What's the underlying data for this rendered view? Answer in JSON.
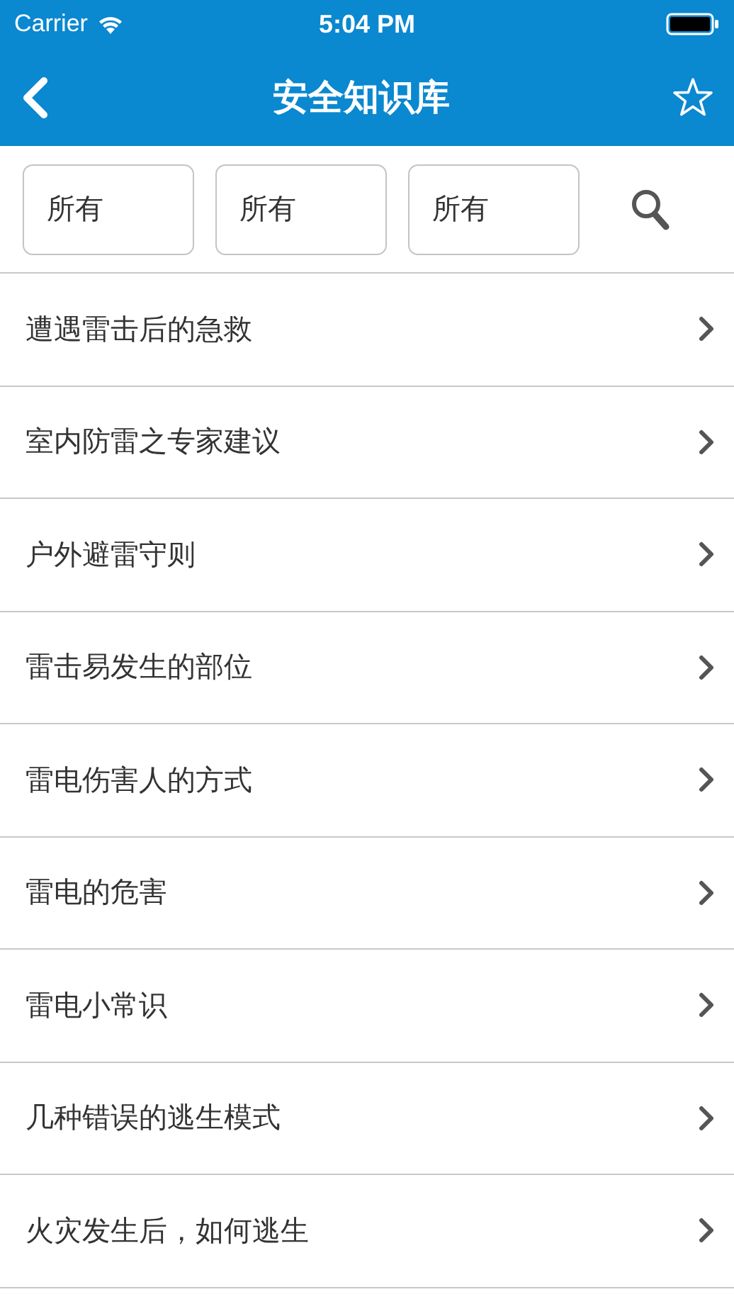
{
  "status_bar": {
    "carrier": "Carrier",
    "time": "5:04 PM"
  },
  "nav": {
    "title": "安全知识库"
  },
  "filters": [
    {
      "value": "所有"
    },
    {
      "value": "所有"
    },
    {
      "value": "所有"
    }
  ],
  "articles": [
    {
      "title": "遭遇雷击后的急救"
    },
    {
      "title": "室内防雷之专家建议"
    },
    {
      "title": "户外避雷守则"
    },
    {
      "title": "雷击易发生的部位"
    },
    {
      "title": "雷电伤害人的方式"
    },
    {
      "title": "雷电的危害"
    },
    {
      "title": "雷电小常识"
    },
    {
      "title": "几种错误的逃生模式"
    },
    {
      "title": "火灾发生后，如何逃生"
    }
  ]
}
